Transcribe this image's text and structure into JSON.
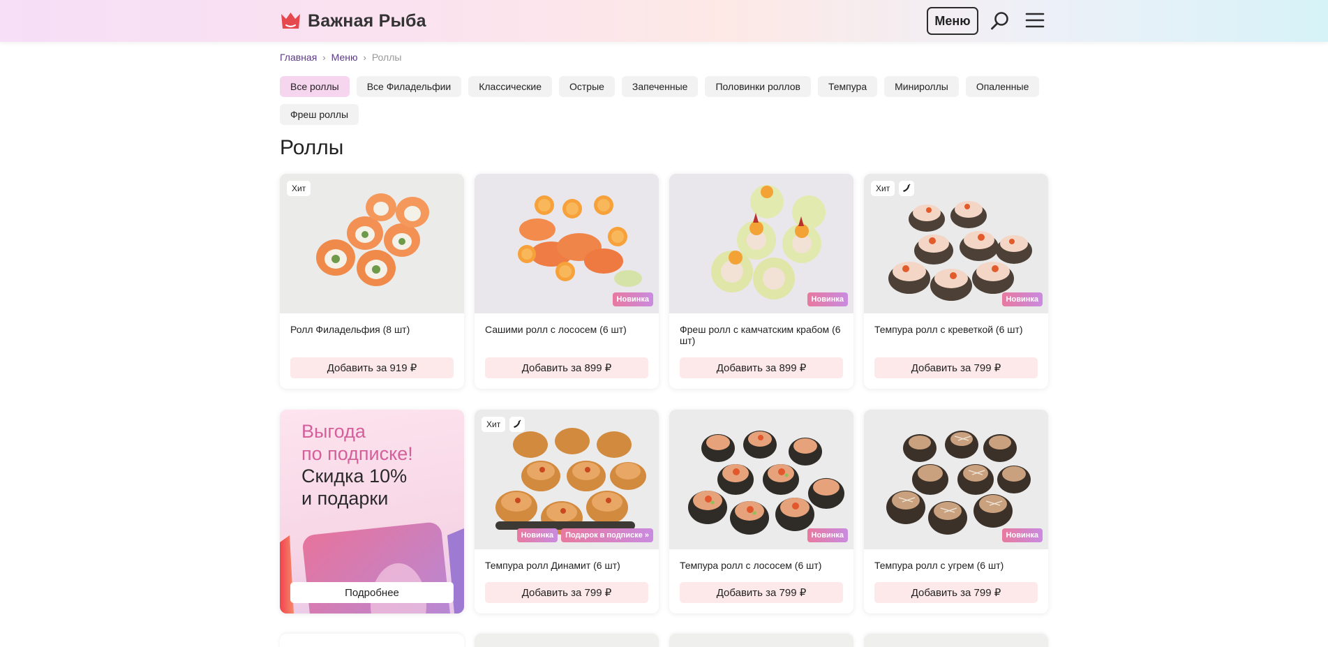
{
  "brand": {
    "name": "Важная Рыба",
    "logo_icon": "crown-icon",
    "accent": "#e5484d"
  },
  "header": {
    "menu_label": "Меню",
    "search_icon": "search-icon",
    "burger_icon": "hamburger-menu-icon"
  },
  "breadcrumb": {
    "home": "Главная",
    "menu": "Меню",
    "current": "Роллы"
  },
  "categories": [
    {
      "label": "Все роллы",
      "active": true
    },
    {
      "label": "Все Филадельфии",
      "active": false
    },
    {
      "label": "Классические",
      "active": false
    },
    {
      "label": "Острые",
      "active": false
    },
    {
      "label": "Запеченные",
      "active": false
    },
    {
      "label": "Половинки роллов",
      "active": false
    },
    {
      "label": "Темпура",
      "active": false
    },
    {
      "label": "Минироллы",
      "active": false
    },
    {
      "label": "Опаленные",
      "active": false
    },
    {
      "label": "Фреш роллы",
      "active": false
    }
  ],
  "page_title": "Роллы",
  "products": [
    {
      "name": "Ролл Филадельфия (8 шт)",
      "button": "Добавить за 919 ₽",
      "hit": "Хит",
      "spicy": false,
      "new": "",
      "gift": ""
    },
    {
      "name": "Сашими ролл с лососем (6 шт)",
      "button": "Добавить за 899 ₽",
      "hit": "",
      "spicy": false,
      "new": "Новинка",
      "gift": ""
    },
    {
      "name": "Фреш ролл с камчатским крабом (6 шт)",
      "button": "Добавить за 899 ₽",
      "hit": "",
      "spicy": false,
      "new": "Новинка",
      "gift": ""
    },
    {
      "name": "Темпура ролл с креветкой (6 шт)",
      "button": "Добавить за 799 ₽",
      "hit": "Хит",
      "spicy": true,
      "new": "Новинка",
      "gift": ""
    },
    {
      "name": "Темпура ролл Динамит (6 шт)",
      "button": "Добавить за 799 ₽",
      "hit": "Хит",
      "spicy": true,
      "new": "Новинка",
      "gift": "Подарок в подписке »"
    },
    {
      "name": "Темпура ролл с лососем (6 шт)",
      "button": "Добавить за 799 ₽",
      "hit": "",
      "spicy": false,
      "new": "Новинка",
      "gift": ""
    },
    {
      "name": "Темпура ролл с угрем (6 шт)",
      "button": "Добавить за 799 ₽",
      "hit": "",
      "spicy": false,
      "new": "Новинка",
      "gift": ""
    }
  ],
  "promo": {
    "line1": "Выгода",
    "line2": "по подписке!",
    "line3": "Скидка 10%",
    "line4": "и подарки",
    "button": "Подробнее"
  }
}
